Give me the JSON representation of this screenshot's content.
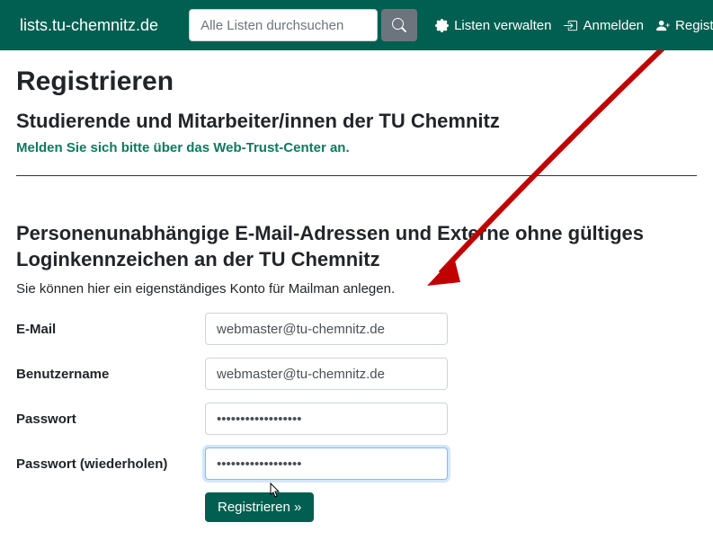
{
  "navbar": {
    "brand": "lists.tu-chemnitz.de",
    "search_placeholder": "Alle Listen durchsuchen",
    "links": {
      "manage": "Listen verwalten",
      "login": "Anmelden",
      "register": "Registrieren"
    }
  },
  "page": {
    "title": "Registrieren",
    "subtitle1": "Studierende und Mitarbeiter/innen der TU Chemnitz",
    "wtc_link": "Melden Sie sich bitte über das Web-Trust-Center an.",
    "subtitle2": "Personenunabhängige E-Mail-Adressen und Externe ohne gültiges Loginkennzeichen an der TU Chemnitz",
    "intro": "Sie können hier ein eigenständiges Konto für Mailman anlegen."
  },
  "form": {
    "email_label": "E-Mail",
    "email_value": "webmaster@tu-chemnitz.de",
    "username_label": "Benutzername",
    "username_value": "webmaster@tu-chemnitz.de",
    "password_label": "Passwort",
    "password_value": "••••••••••••••••••",
    "password2_label": "Passwort (wiederholen)",
    "password2_value": "••••••••••••••••••",
    "submit": "Registrieren »"
  }
}
